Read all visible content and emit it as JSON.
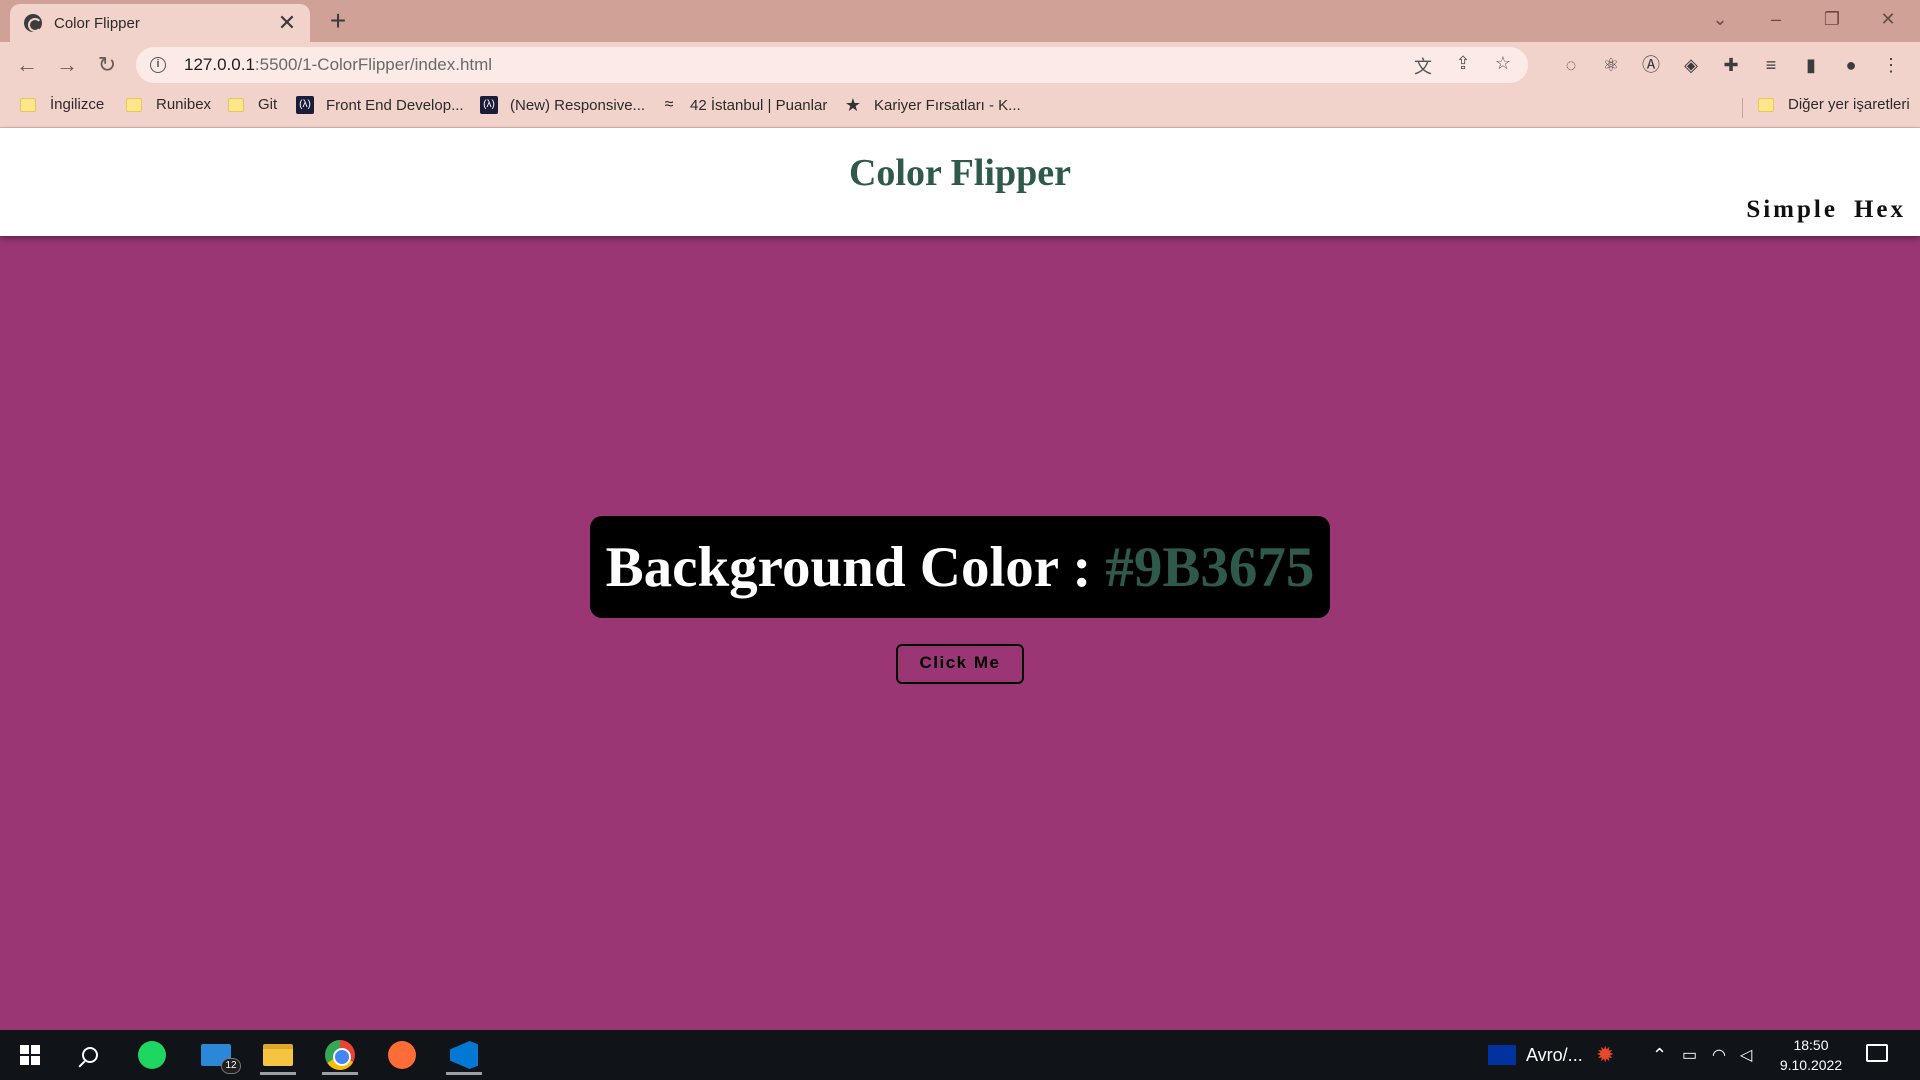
{
  "browser": {
    "tab_title": "Color Flipper",
    "tab_close": "✕",
    "new_tab": "+",
    "url_host": "127.0.0.1",
    "url_path": ":5500/1-ColorFlipper/index.html",
    "window_controls": {
      "minimize": "–",
      "restore": "❐",
      "close": "✕",
      "tabsearch": "⌄"
    },
    "bookmarks": [
      {
        "label": "İngilizce",
        "icon": "folder-icon"
      },
      {
        "label": "Runibex",
        "icon": "folder-icon"
      },
      {
        "label": "Git",
        "icon": "folder-icon"
      },
      {
        "label": "Front End Develop...",
        "icon": "fcc-icon"
      },
      {
        "label": "(New) Responsive...",
        "icon": "fcc-icon"
      },
      {
        "label": "42 İstanbul | Puanlar",
        "icon": "swimmer-icon"
      },
      {
        "label": "Kariyer Fırsatları - K...",
        "icon": "star-logo-icon"
      }
    ],
    "other_bookmarks": "Diğer yer işaretleri"
  },
  "page": {
    "title": "Color Flipper",
    "nav": [
      "Simple",
      "Hex"
    ],
    "color_label": "Background Color :",
    "color_value": "#9B3675",
    "button_label": "Click Me",
    "colors": {
      "background": "#9B3675",
      "accent": "#2f5a4b"
    }
  },
  "taskbar": {
    "mail_badge": "12",
    "currency_label": "Avro/...",
    "time": "18:50",
    "date": "9.10.2022"
  }
}
